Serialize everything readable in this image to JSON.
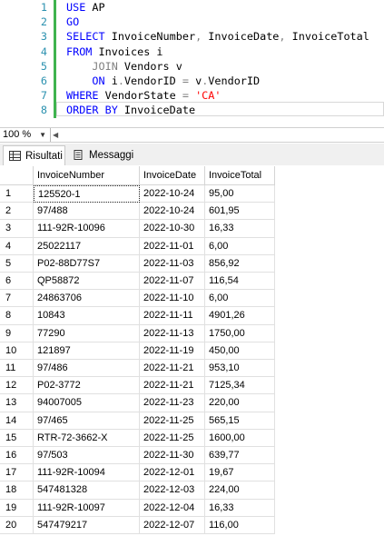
{
  "editor": {
    "lines": [
      {
        "num": "1",
        "parts": [
          {
            "t": "USE ",
            "c": "kw"
          },
          {
            "t": "AP",
            "c": "id"
          }
        ]
      },
      {
        "num": "2",
        "parts": [
          {
            "t": "GO",
            "c": "kw"
          }
        ]
      },
      {
        "num": "3",
        "parts": [
          {
            "t": "SELECT ",
            "c": "kw"
          },
          {
            "t": "InvoiceNumber",
            "c": "id"
          },
          {
            "t": ", ",
            "c": "kwg"
          },
          {
            "t": "InvoiceDate",
            "c": "id"
          },
          {
            "t": ", ",
            "c": "kwg"
          },
          {
            "t": "InvoiceTotal",
            "c": "id"
          }
        ]
      },
      {
        "num": "4",
        "parts": [
          {
            "t": "FROM ",
            "c": "kw"
          },
          {
            "t": "Invoices i",
            "c": "id"
          }
        ]
      },
      {
        "num": "5",
        "parts": [
          {
            "t": "    JOIN ",
            "c": "kwg"
          },
          {
            "t": "Vendors v",
            "c": "id"
          }
        ]
      },
      {
        "num": "6",
        "parts": [
          {
            "t": "    ON ",
            "c": "kw"
          },
          {
            "t": "i",
            "c": "id"
          },
          {
            "t": ".",
            "c": "kwg"
          },
          {
            "t": "VendorID ",
            "c": "id"
          },
          {
            "t": "= ",
            "c": "kwg"
          },
          {
            "t": "v",
            "c": "id"
          },
          {
            "t": ".",
            "c": "kwg"
          },
          {
            "t": "VendorID",
            "c": "id"
          }
        ]
      },
      {
        "num": "7",
        "parts": [
          {
            "t": "WHERE ",
            "c": "kw"
          },
          {
            "t": "VendorState ",
            "c": "id"
          },
          {
            "t": "= ",
            "c": "kwg"
          },
          {
            "t": "'CA'",
            "c": "str"
          }
        ]
      },
      {
        "num": "8",
        "parts": [
          {
            "t": "ORDER BY ",
            "c": "kw"
          },
          {
            "t": "InvoiceDate",
            "c": "id"
          }
        ]
      }
    ]
  },
  "zoom": {
    "value": "100 %"
  },
  "tabs": {
    "results": "Risultati",
    "messages": "Messaggi"
  },
  "grid": {
    "columns": [
      "",
      "InvoiceNumber",
      "InvoiceDate",
      "InvoiceTotal"
    ],
    "rows": [
      [
        "1",
        "125520-1",
        "2022-10-24",
        "95,00"
      ],
      [
        "2",
        "97/488",
        "2022-10-24",
        "601,95"
      ],
      [
        "3",
        "111-92R-10096",
        "2022-10-30",
        "16,33"
      ],
      [
        "4",
        "25022117",
        "2022-11-01",
        "6,00"
      ],
      [
        "5",
        "P02-88D77S7",
        "2022-11-03",
        "856,92"
      ],
      [
        "6",
        "QP58872",
        "2022-11-07",
        "116,54"
      ],
      [
        "7",
        "24863706",
        "2022-11-10",
        "6,00"
      ],
      [
        "8",
        "10843",
        "2022-11-11",
        "4901,26"
      ],
      [
        "9",
        "77290",
        "2022-11-13",
        "1750,00"
      ],
      [
        "10",
        "121897",
        "2022-11-19",
        "450,00"
      ],
      [
        "11",
        "97/486",
        "2022-11-21",
        "953,10"
      ],
      [
        "12",
        "P02-3772",
        "2022-11-21",
        "7125,34"
      ],
      [
        "13",
        "94007005",
        "2022-11-23",
        "220,00"
      ],
      [
        "14",
        "97/465",
        "2022-11-25",
        "565,15"
      ],
      [
        "15",
        "RTR-72-3662-X",
        "2022-11-25",
        "1600,00"
      ],
      [
        "16",
        "97/503",
        "2022-11-30",
        "639,77"
      ],
      [
        "17",
        "111-92R-10094",
        "2022-12-01",
        "19,67"
      ],
      [
        "18",
        "547481328",
        "2022-12-03",
        "224,00"
      ],
      [
        "19",
        "111-92R-10097",
        "2022-12-04",
        "16,33"
      ],
      [
        "20",
        "547479217",
        "2022-12-07",
        "116,00"
      ]
    ]
  }
}
